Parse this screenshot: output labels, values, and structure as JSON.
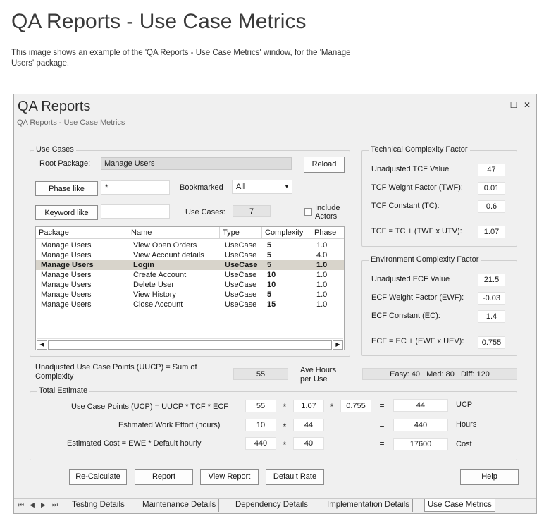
{
  "doc": {
    "title": "QA Reports - Use Case Metrics",
    "description": "This image shows an example of the 'QA Reports - Use Case Metrics' window, for the 'Manage Users' package."
  },
  "window": {
    "title": "QA Reports",
    "subtitle": "QA Reports - Use Case Metrics",
    "maximize_glyph": "☐",
    "close_glyph": "✕"
  },
  "use_cases": {
    "legend": "Use Cases",
    "root_package_label": "Root Package:",
    "root_package_value": "Manage Users",
    "reload": "Reload",
    "phase_like_button": "Phase like",
    "phase_like_value": "*",
    "bookmarked_label": "Bookmarked",
    "bookmarked_value": "All",
    "keyword_like_button": "Keyword like",
    "keyword_like_value": "",
    "use_cases_label": "Use Cases:",
    "use_cases_count": "7",
    "include_actors_line1": "Include",
    "include_actors_line2": "Actors",
    "include_actors_checked": false
  },
  "table": {
    "columns": [
      "Package",
      "Name",
      "Type",
      "Complexity",
      "Phase"
    ],
    "rows": [
      [
        "Manage Users",
        "View Open Orders",
        "UseCase",
        "5",
        "1.0"
      ],
      [
        "Manage Users",
        "View Account details",
        "UseCase",
        "5",
        "4.0"
      ],
      [
        "Manage Users",
        "Login",
        "UseCase",
        "5",
        "1.0"
      ],
      [
        "Manage Users",
        "Create Account",
        "UseCase",
        "10",
        "1.0"
      ],
      [
        "Manage Users",
        "Delete User",
        "UseCase",
        "10",
        "1.0"
      ],
      [
        "Manage Users",
        "View History",
        "UseCase",
        "5",
        "1.0"
      ],
      [
        "Manage Users",
        "Close Account",
        "UseCase",
        "15",
        "1.0"
      ]
    ],
    "selected_row": 2
  },
  "tcf": {
    "legend": "Technical Complexity Factor",
    "unadjusted_label": "Unadjusted TCF Value",
    "unadjusted_value": "47",
    "weight_label": "TCF Weight Factor (TWF):",
    "weight_value": "0.01",
    "constant_label": "TCF Constant (TC):",
    "constant_value": "0.6",
    "formula_label": "TCF = TC + (TWF x UTV):",
    "formula_value": "1.07"
  },
  "ecf": {
    "legend": "Environment Complexity Factor",
    "unadjusted_label": "Unadjusted ECF Value",
    "unadjusted_value": "21.5",
    "weight_label": "ECF Weight Factor (EWF):",
    "weight_value": "-0.03",
    "constant_label": "ECF Constant (EC):",
    "constant_value": "1.4",
    "formula_label": "ECF  = EC + (EWF x UEV):",
    "formula_value": "0.755"
  },
  "uucp": {
    "label_line1": "Unadjusted Use Case Points (UUCP) = Sum of",
    "label_line2": "Complexity",
    "value": "55",
    "ave_hours_line1": "Ave Hours",
    "ave_hours_line2": "per Use",
    "difficulty": "Easy: 40   Med: 80   Diff: 120"
  },
  "total": {
    "legend": "Total Estimate",
    "ucp_label": "Use Case Points (UCP) = UUCP * TCF * ECF",
    "ucp_a": "55",
    "ucp_b": "1.07",
    "ucp_c": "0.755",
    "ucp_result": "44",
    "ucp_unit": "UCP",
    "effort_label": "Estimated Work Effort (hours)",
    "effort_a": "10",
    "effort_b": "44",
    "effort_result": "440",
    "effort_unit": "Hours",
    "cost_label": "Estimated Cost  = EWE * Default hourly",
    "cost_a": "440",
    "cost_b": "40",
    "cost_result": "17600",
    "cost_unit": "Cost",
    "times": "*",
    "equals": "="
  },
  "buttons": {
    "recalculate": "Re-Calculate",
    "report": "Report",
    "view_report": "View Report",
    "default_rate": "Default Rate",
    "help": "Help"
  },
  "tabs": [
    "Testing Details",
    "Maintenance Details",
    "Dependency Details",
    "Implementation Details",
    "Use Case Metrics"
  ],
  "nav": [
    "⏮",
    "◀",
    "▶",
    "⏭"
  ]
}
